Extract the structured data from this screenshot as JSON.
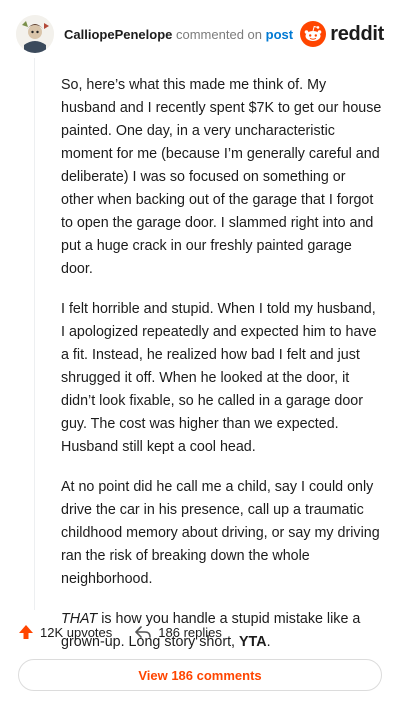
{
  "header": {
    "author": "CalliopePenelope",
    "commented_text": "commented on",
    "post_link": "post",
    "brand": "reddit"
  },
  "comment": {
    "paragraphs": [
      "So, here’s what this made me think of. My husband and I recently spent $7K to get our house painted. One day, in a very uncharacteristic moment for me (because I’m generally careful and deliberate) I was so focused on something or other when backing out of the garage that I forgot to open the garage door. I slammed right into and put a huge crack in our freshly painted garage door.",
      "I felt horrible and stupid. When I told my husband, I apologized repeatedly and expected him to have a fit. Instead, he realized how bad I felt and just shrugged it off. When he looked at the door, it didn’t look fixable, so he called in a garage door guy. The cost was higher than we expected. Husband still kept a cool head.",
      "At no point did he call me a child, say I could only drive the car in his presence, call up a traumatic childhood memory about driving, or say my driving ran the risk of breaking down the whole neighborhood."
    ],
    "last_paragraph": {
      "emph": "THAT",
      "middle": " is how you handle a stupid mistake like a grown-up. Long story short, ",
      "strong": "YTA",
      "end": "."
    }
  },
  "actions": {
    "upvotes": "12K upvotes",
    "replies": "186 replies"
  },
  "view_comments": "View 186 comments",
  "colors": {
    "accent": "#ff4500",
    "link": "#0079d3"
  },
  "icons": {
    "upvote": "upvote-arrow-icon",
    "reply": "reply-arrow-icon",
    "brand": "reddit-snoo-icon",
    "avatar": "user-avatar"
  }
}
